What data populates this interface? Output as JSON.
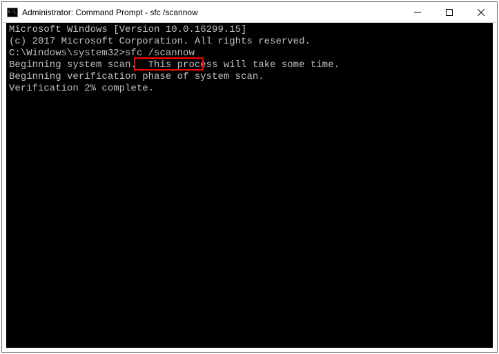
{
  "titlebar": {
    "title": "Administrator: Command Prompt - sfc  /scannow"
  },
  "terminal": {
    "line1": "Microsoft Windows [Version 10.0.16299.15]",
    "line2": "(c) 2017 Microsoft Corporation. All rights reserved.",
    "blank1": "",
    "prompt": "C:\\Windows\\system32>",
    "command": "sfc /scannow",
    "blank2": "",
    "line3": "Beginning system scan.  This process will take some time.",
    "blank3": "",
    "line4": "Beginning verification phase of system scan.",
    "line5": "Verification 2% complete."
  }
}
